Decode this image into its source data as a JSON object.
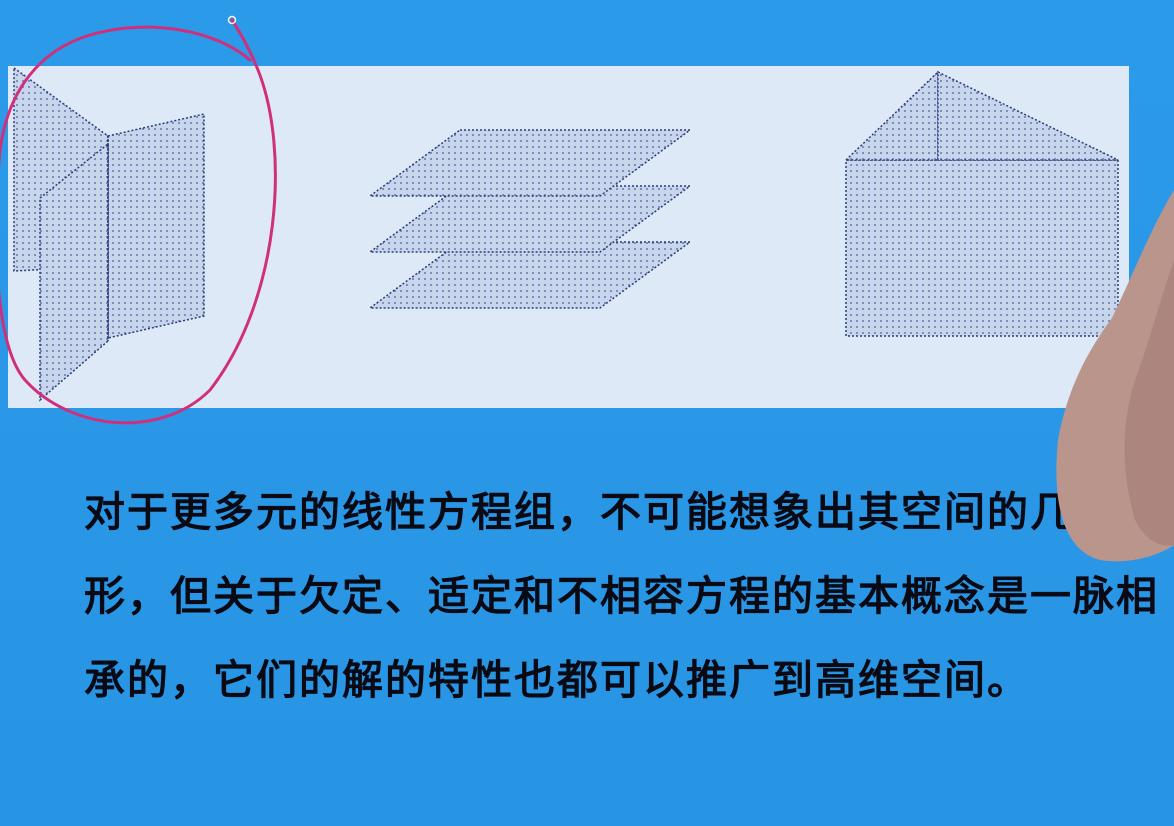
{
  "figures": [
    {
      "name": "intersecting-planes"
    },
    {
      "name": "parallel-planes"
    },
    {
      "name": "folded-planes"
    }
  ],
  "text": {
    "paragraph": "对于更多元的线性方程组，不可能想象出其空间的几何图形，但关于欠定、适定和不相容方程的基本概念是一脉相承的，它们的解的特性也都可以推广到高维空间。"
  },
  "colors": {
    "background": "#2a97e6",
    "panel": "#dde9f6",
    "plane_fill": "#c6d5ec",
    "plane_stroke": "#2c3a7a",
    "annotation": "#d0307a"
  }
}
